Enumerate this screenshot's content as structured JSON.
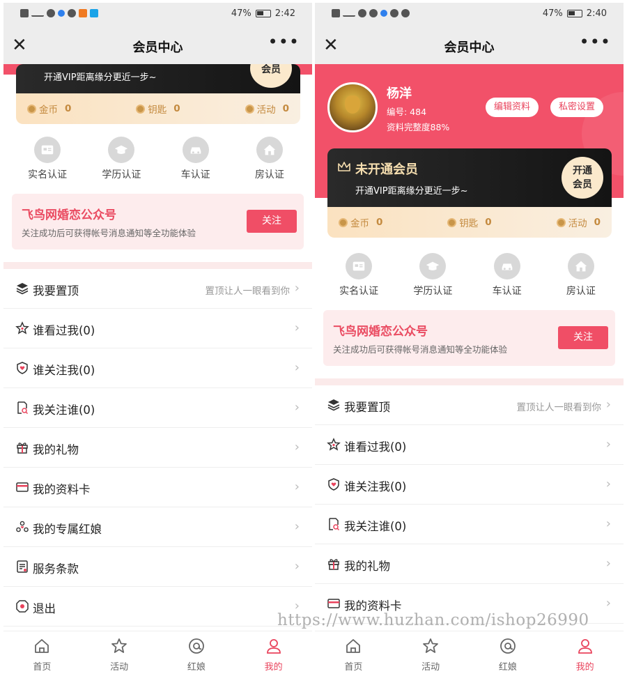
{
  "statusbar": {
    "left": {
      "battery_pct": "47%",
      "time": "2:42"
    },
    "right": {
      "battery_pct": "47%",
      "time": "2:40"
    }
  },
  "navbar": {
    "close_icon": "close-icon",
    "title": "会员中心",
    "more_icon": "more-icon"
  },
  "profile": {
    "name": "杨洋",
    "id_line": "编号: 484",
    "completeness": "资料完整度88%",
    "edit_label": "编辑资料",
    "privacy_label": "私密设置"
  },
  "vip": {
    "title": "未开通会员",
    "desc": "开通VIP距离缘分更近一步~",
    "button_line1": "开通",
    "button_line2": "会员",
    "button_partial": "会员"
  },
  "wallet": [
    {
      "label": "金币",
      "value": "0",
      "icon": "coin-icon"
    },
    {
      "label": "钥匙",
      "value": "0",
      "icon": "key-icon"
    },
    {
      "label": "活动",
      "value": "0",
      "icon": "activity-icon"
    }
  ],
  "certifications": [
    {
      "label": "实名认证",
      "icon": "id-card-icon"
    },
    {
      "label": "学历认证",
      "icon": "graduation-cap-icon"
    },
    {
      "label": "车认证",
      "icon": "car-icon"
    },
    {
      "label": "房认证",
      "icon": "house-icon"
    }
  ],
  "promo": {
    "title": "飞鸟网婚恋公众号",
    "subtitle": "关注成功后可获得帐号消息通知等全功能体验",
    "button": "关注"
  },
  "menu": [
    {
      "label": "我要置顶",
      "hint": "置顶让人一眼看到你",
      "icon": "layers-icon"
    },
    {
      "label": "谁看过我(0)",
      "hint": "",
      "icon": "star-icon"
    },
    {
      "label": "谁关注我(0)",
      "hint": "",
      "icon": "heart-shield-icon"
    },
    {
      "label": "我关注谁(0)",
      "hint": "",
      "icon": "doc-search-icon"
    },
    {
      "label": "我的礼物",
      "hint": "",
      "icon": "gift-icon"
    },
    {
      "label": "我的资料卡",
      "hint": "",
      "icon": "card-icon"
    },
    {
      "label": "我的专属红娘",
      "hint": "",
      "icon": "matchmaker-icon"
    },
    {
      "label": "服务条款",
      "hint": "",
      "icon": "terms-icon"
    },
    {
      "label": "退出",
      "hint": "",
      "icon": "logout-icon"
    }
  ],
  "tabs": [
    {
      "label": "首页",
      "icon": "home-icon"
    },
    {
      "label": "活动",
      "icon": "star-icon"
    },
    {
      "label": "红娘",
      "icon": "at-icon"
    },
    {
      "label": "我的",
      "icon": "user-icon"
    }
  ],
  "active_tab": "我的",
  "watermark": "https://www.huzhan.com/ishop26990",
  "colors": {
    "accent": "#f25169",
    "vip_dark": "#1e1e1e",
    "gold": "#c48a3f"
  }
}
